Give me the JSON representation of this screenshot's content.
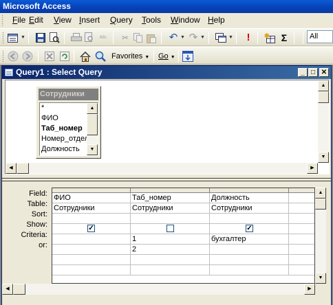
{
  "app": {
    "title": "Microsoft Access"
  },
  "menu": {
    "items": [
      {
        "label": "File",
        "hot": "F",
        "rest": "ile"
      },
      {
        "label": "Edit",
        "hot": "E",
        "rest": "dit"
      },
      {
        "label": "View",
        "hot": "V",
        "rest": "iew"
      },
      {
        "label": "Insert",
        "hot": "I",
        "rest": "nsert"
      },
      {
        "label": "Query",
        "hot": "Q",
        "rest": "uery"
      },
      {
        "label": "Tools",
        "hot": "T",
        "rest": "ools"
      },
      {
        "label": "Window",
        "hot": "W",
        "rest": "indow"
      },
      {
        "label": "Help",
        "hot": "H",
        "rest": "elp"
      }
    ]
  },
  "toolbar": {
    "sigma": "Σ",
    "font_value": "All",
    "favorites_label": "Favorites",
    "go_label": "Go"
  },
  "query_window": {
    "title": "Query1 : Select Query",
    "buttons": {
      "minimize": "_",
      "maximize": "□",
      "close": "✕"
    }
  },
  "field_list": {
    "title": "Сотрудники",
    "fields": [
      {
        "name": "*",
        "bold": false
      },
      {
        "name": "ФИО",
        "bold": false
      },
      {
        "name": "Таб_номер",
        "bold": true
      },
      {
        "name": "Номер_отдела",
        "bold": false
      },
      {
        "name": "Должность",
        "bold": false
      }
    ]
  },
  "grid": {
    "row_labels": {
      "field": "Field:",
      "table": "Table:",
      "sort": "Sort:",
      "show": "Show:",
      "criteria": "Criteria:",
      "or": "or:"
    },
    "columns": [
      {
        "field": "ФИО",
        "table": "Сотрудники",
        "sort": "",
        "show": true,
        "criteria": "",
        "or": ""
      },
      {
        "field": "Таб_номер",
        "table": "Сотрудники",
        "sort": "",
        "show": false,
        "criteria": "1",
        "or": "2"
      },
      {
        "field": "Должность",
        "table": "Сотрудники",
        "sort": "",
        "show": true,
        "criteria": "бухгалтер",
        "or": ""
      },
      {
        "field": "",
        "table": "",
        "sort": "",
        "show": null,
        "criteria": "",
        "or": ""
      }
    ]
  },
  "colors": {
    "title_bar": "#0a5bd6",
    "mdi_title": "#0a246a",
    "checkbox": "#1c5180"
  }
}
